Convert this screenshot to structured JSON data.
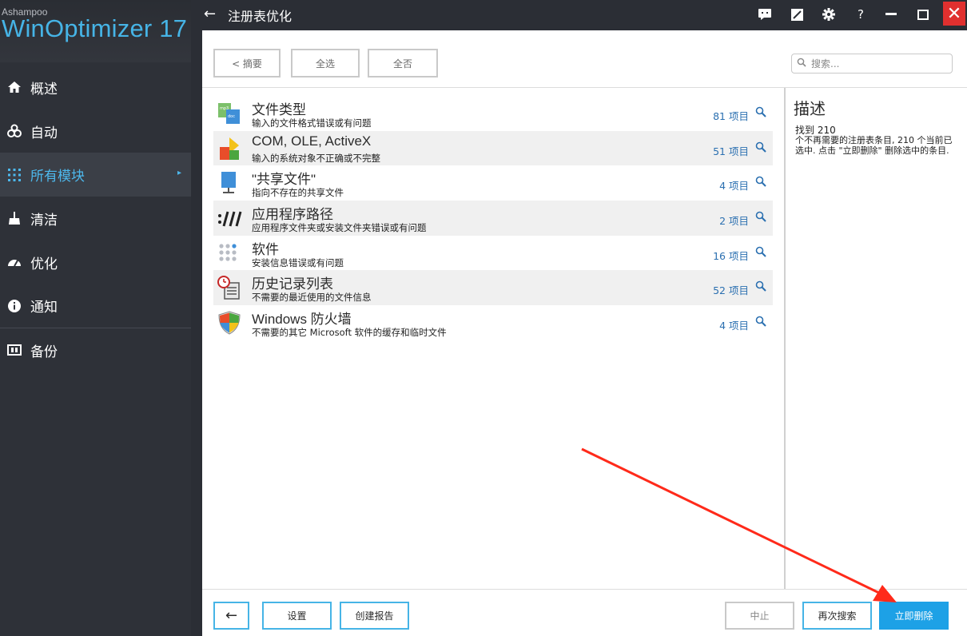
{
  "app": {
    "vendor": "Ashampoo",
    "product": "WinOptimizer 17"
  },
  "sidebar": {
    "items": [
      {
        "label": "概述",
        "icon": "home-icon"
      },
      {
        "label": "自动",
        "icon": "auto-icon"
      },
      {
        "label": "所有模块",
        "icon": "grid-icon",
        "active": true
      },
      {
        "label": "清洁",
        "icon": "broom-icon"
      },
      {
        "label": "优化",
        "icon": "speedometer-icon"
      },
      {
        "label": "通知",
        "icon": "info-icon"
      },
      {
        "label": "备份",
        "icon": "backup-icon"
      }
    ]
  },
  "titlebar": {
    "back_icon": "←",
    "title": "注册表优化",
    "help": "?",
    "close": "✕"
  },
  "toolbar": {
    "summary": "< 摘要",
    "select_all": "全选",
    "select_none": "全否",
    "search_placeholder": "搜索..."
  },
  "list": [
    {
      "title": "文件类型",
      "subtitle": "输入的文件格式错误或有问题",
      "count": "81 项目",
      "icon": "file-types-icon"
    },
    {
      "title": "COM, OLE, ActiveX",
      "subtitle": "输入的系统对象不正确或不完整",
      "count": "51 项目",
      "icon": "shapes-icon"
    },
    {
      "title": "\"共享文件\"",
      "subtitle": "指向不存在的共享文件",
      "count": "4 项目",
      "icon": "shared-file-icon"
    },
    {
      "title": "应用程序路径",
      "subtitle": "应用程序文件夹或安装文件夹错误或有问题",
      "count": "2 项目",
      "icon": "path-icon"
    },
    {
      "title": "软件",
      "subtitle": "安装信息错误或有问题",
      "count": "16 项目",
      "icon": "software-icon"
    },
    {
      "title": "历史记录列表",
      "subtitle": "不需要的最近使用的文件信息",
      "count": "52 项目",
      "icon": "history-icon"
    },
    {
      "title": "Windows 防火墙",
      "subtitle": "不需要的其它 Microsoft 软件的缓存和临时文件",
      "count": "4 项目",
      "icon": "firewall-shield-icon"
    }
  ],
  "description": {
    "heading": "描述",
    "found": "找到 210",
    "body": "个不再需要的注册表条目, 210 个当前已选中. 点击 \"立即删除\" 删除选中的条目."
  },
  "bottombar": {
    "back_icon": "←",
    "settings": "设置",
    "create_report": "创建报告",
    "abort": "中止",
    "search_again": "再次搜索",
    "delete_now": "立即删除"
  },
  "colors": {
    "accent": "#46b4e6",
    "sidebar_bg": "#2e3138",
    "close_red": "#e0302f",
    "primary_button": "#1da1e6",
    "annotation_arrow": "#ff2a1a"
  }
}
